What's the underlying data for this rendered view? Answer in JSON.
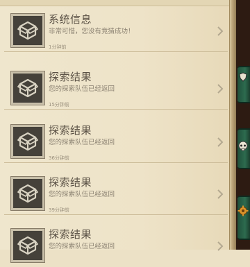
{
  "messages": [
    {
      "title": "系统信息",
      "subtitle": "非常可惜，您没有竞猜成功！",
      "time": "1分钟前",
      "icon": "box-icon"
    },
    {
      "title": "探索结果",
      "subtitle": "您的探索队伍已经返回",
      "time": "15分钟前",
      "icon": "box-icon"
    },
    {
      "title": "探索结果",
      "subtitle": "您的探索队伍已经返回",
      "time": "36分钟前",
      "icon": "box-icon"
    },
    {
      "title": "探索结果",
      "subtitle": "您的探索队伍已经返回",
      "time": "39分钟前",
      "icon": "box-icon"
    },
    {
      "title": "探索结果",
      "subtitle": "您的探索队伍已经返回",
      "time": "",
      "icon": "box-icon"
    }
  ],
  "colors": {
    "paper": "#eee3c8",
    "title_text": "#5a5145",
    "subtitle_text": "#8b8272",
    "icon_dark": "#45413a",
    "side_green": "#2d6b4f"
  }
}
